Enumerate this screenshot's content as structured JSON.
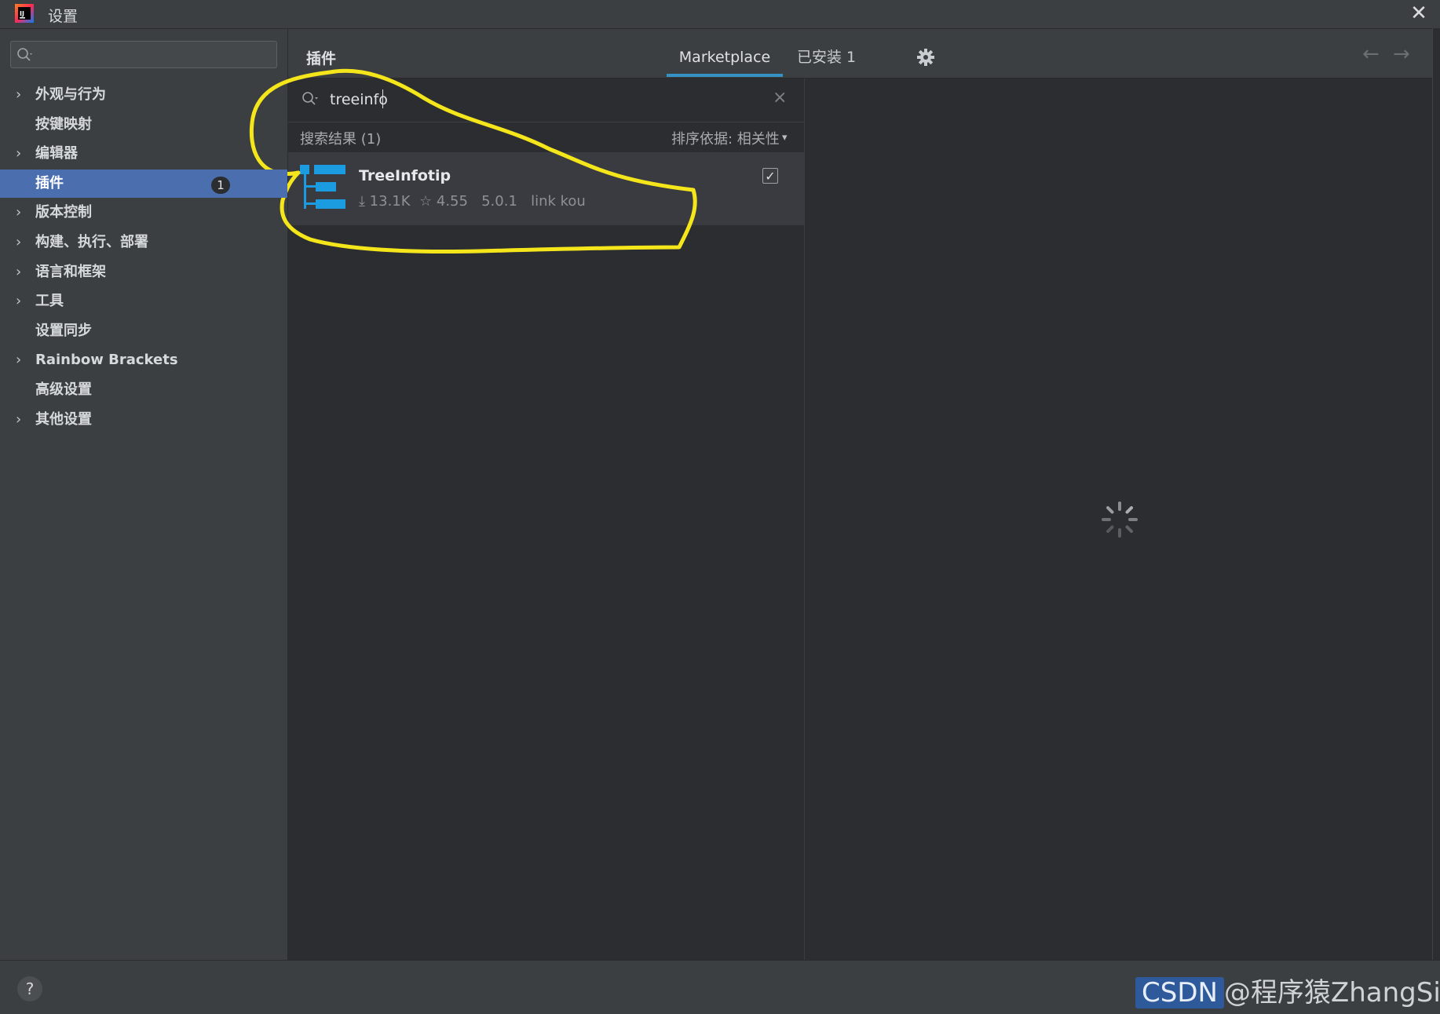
{
  "window": {
    "title": "设置",
    "close_label": "✕"
  },
  "sidebar": {
    "search_placeholder": "",
    "items": [
      {
        "label": "外观与行为",
        "expandable": true,
        "selected": false
      },
      {
        "label": "按键映射",
        "expandable": false,
        "selected": false
      },
      {
        "label": "编辑器",
        "expandable": true,
        "selected": false
      },
      {
        "label": "插件",
        "expandable": false,
        "selected": true,
        "badge": "1"
      },
      {
        "label": "版本控制",
        "expandable": true,
        "selected": false
      },
      {
        "label": "构建、执行、部署",
        "expandable": true,
        "selected": false
      },
      {
        "label": "语言和框架",
        "expandable": true,
        "selected": false
      },
      {
        "label": "工具",
        "expandable": true,
        "selected": false
      },
      {
        "label": "设置同步",
        "expandable": false,
        "selected": false
      },
      {
        "label": "Rainbow Brackets",
        "expandable": true,
        "selected": false
      },
      {
        "label": "高级设置",
        "expandable": false,
        "selected": false
      },
      {
        "label": "其他设置",
        "expandable": true,
        "selected": false
      }
    ],
    "chevron": "›"
  },
  "header": {
    "title": "插件",
    "tabs": [
      {
        "label": "Marketplace",
        "active": true
      },
      {
        "label": "已安装  1",
        "active": false
      }
    ],
    "gear_icon": "gear-icon",
    "back_arrow": "←",
    "forward_arrow": "→"
  },
  "plugin_search": {
    "value": "treeinfo",
    "clear_label": "×"
  },
  "results": {
    "count_label": "搜索结果 (1)",
    "sort_label": "排序依据: 相关性",
    "sort_caret": "▾"
  },
  "plugin": {
    "name": "TreeInfotip",
    "meta": "⤓ 13.1K  ☆ 4.55   5.0.1   link kou",
    "installed_check": "✓",
    "icon_color": "#1b9be0"
  },
  "footer": {
    "help_label": "?"
  },
  "watermark": {
    "badge": "CSDN",
    "text": "@程序猿ZhangSir"
  },
  "colors": {
    "accent": "#4b6eaf",
    "tab_underline": "#3592c4",
    "annotation": "#f5e61b"
  }
}
